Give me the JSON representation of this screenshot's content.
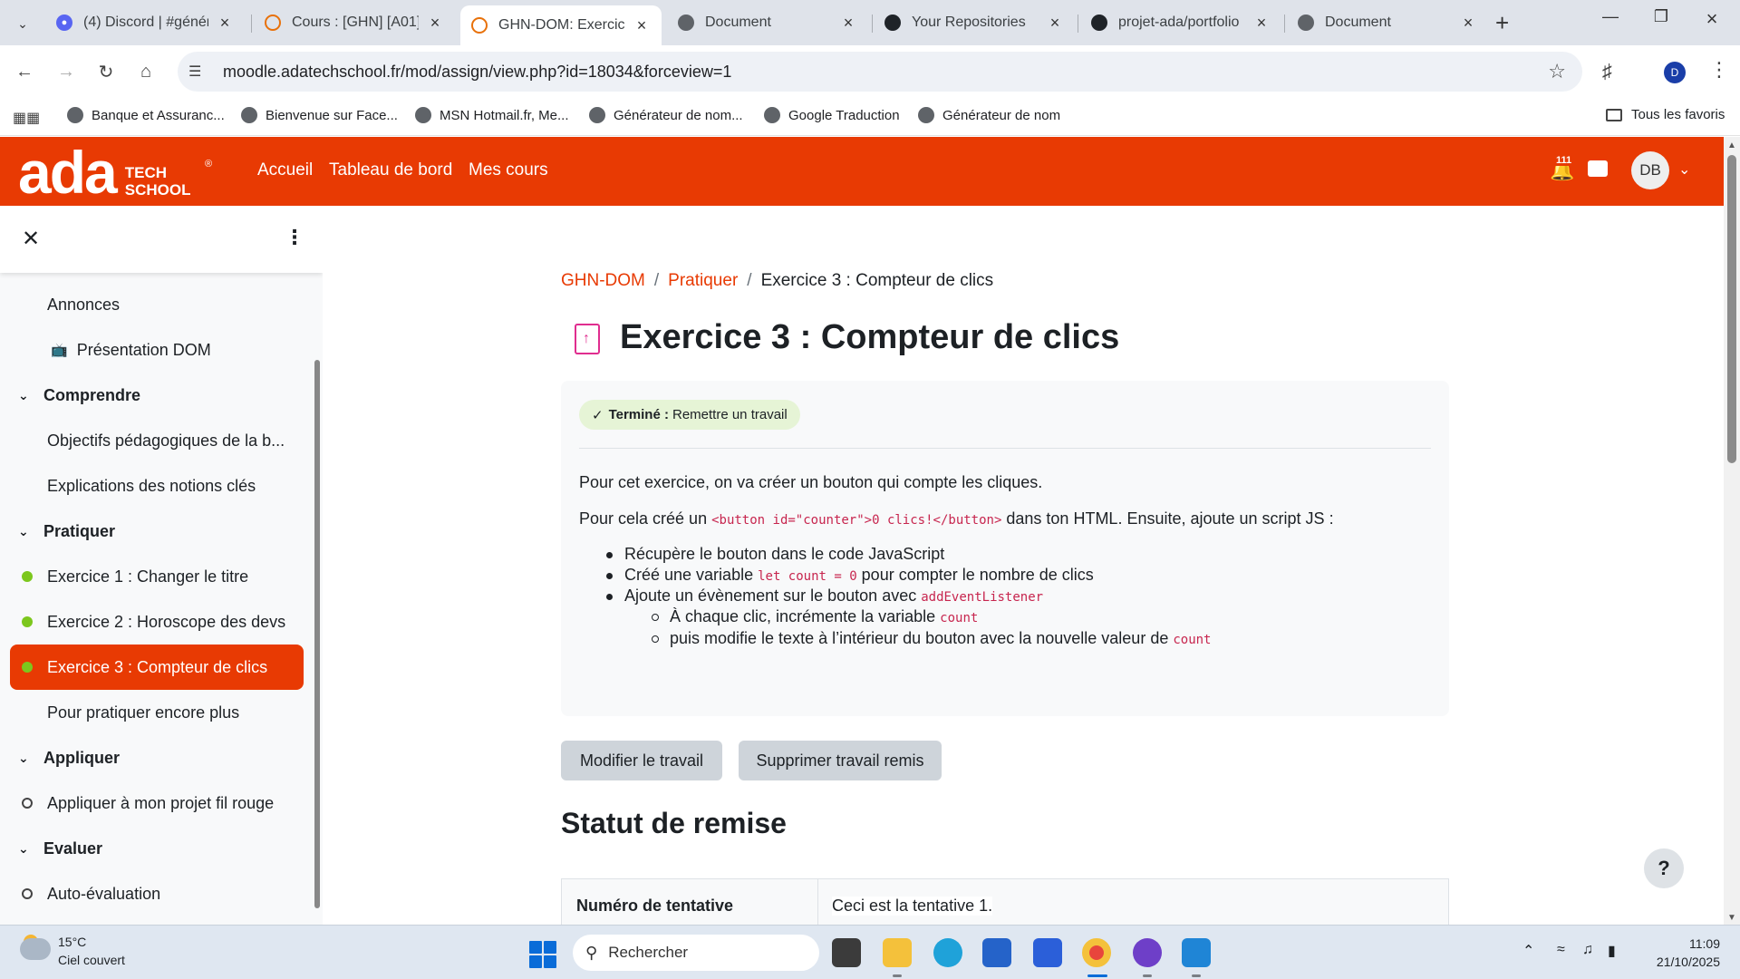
{
  "browser": {
    "tabs": [
      {
        "title": "(4) Discord | #généra",
        "icon": "discord-icon",
        "badge": "4"
      },
      {
        "title": "Cours : [GHN] [A01] T",
        "icon": "globe-icon"
      },
      {
        "title": "GHN-DOM: Exercice",
        "icon": "globe-icon",
        "active": true
      },
      {
        "title": "Document",
        "icon": "globe-icon"
      },
      {
        "title": "Your Repositories",
        "icon": "github-icon"
      },
      {
        "title": "projet-ada/portfolio",
        "icon": "github-icon"
      },
      {
        "title": "Document",
        "icon": "globe-icon"
      }
    ],
    "url": "moodle.adatechschool.fr/mod/assign/view.php?id=18034&forceview=1",
    "profile_initial": "D",
    "bookmarks": [
      "Banque et Assuranc...",
      "Bienvenue sur Face...",
      "MSN Hotmail.fr, Me...",
      "Générateur de nom...",
      "Google Traduction",
      "Générateur de nom"
    ],
    "all_bookmarks": "Tous les favoris"
  },
  "header": {
    "logo_main": "ada",
    "logo_line1": "TECH",
    "logo_line2": "SCHOOL",
    "logo_reg": "®",
    "nav": [
      "Accueil",
      "Tableau de bord",
      "Mes cours"
    ],
    "notification_count": "111",
    "user_initials": "DB",
    "brand_color": "#e83a03"
  },
  "course_index": {
    "items": [
      {
        "label": "Annonces",
        "type": "activity",
        "status": "none"
      },
      {
        "label": "Présentation DOM",
        "type": "activity",
        "status": "none",
        "icon": "tv-icon"
      },
      {
        "label": "Comprendre",
        "type": "section"
      },
      {
        "label": "Objectifs pédagogiques de la b...",
        "type": "activity",
        "status": "none"
      },
      {
        "label": "Explications des notions clés",
        "type": "activity",
        "status": "none"
      },
      {
        "label": "Pratiquer",
        "type": "section"
      },
      {
        "label": "Exercice 1 : Changer le titre",
        "type": "activity",
        "status": "done"
      },
      {
        "label": "Exercice 2 : Horoscope des devs",
        "type": "activity",
        "status": "done"
      },
      {
        "label": "Exercice 3 : Compteur de clics",
        "type": "activity",
        "status": "done",
        "active": true
      },
      {
        "label": "Pour pratiquer encore plus",
        "type": "activity",
        "status": "none"
      },
      {
        "label": "Appliquer",
        "type": "section"
      },
      {
        "label": "Appliquer à mon projet fil rouge",
        "type": "activity",
        "status": "todo"
      },
      {
        "label": "Evaluer",
        "type": "section"
      },
      {
        "label": "Auto-évaluation",
        "type": "activity",
        "status": "todo"
      }
    ]
  },
  "main": {
    "breadcrumb": [
      "GHN-DOM",
      "Pratiquer",
      "Exercice 3 : Compteur de clics"
    ],
    "title": "Exercice 3 : Compteur de clics",
    "completion": {
      "status": "Terminé :",
      "text": "Remettre un travail"
    },
    "intro": {
      "p1": "Pour cet exercice, on va créer un bouton qui compte les cliques.",
      "p2_before": "Pour cela créé un ",
      "p2_code": "<button id=\"counter\">0 clics!</button>",
      "p2_after": " dans ton HTML. Ensuite, ajoute un script JS :",
      "b1": "Récupère le bouton dans le code JavaScript",
      "b2_before": "Créé une variable ",
      "b2_code": "let count = 0",
      "b2_after": " pour compter le nombre de clics",
      "b3_before": "Ajoute un évènement sur le bouton avec ",
      "b3_code": "addEventListener",
      "s1_before": "À chaque clic, incrémente la variable ",
      "s1_code": "count",
      "s2_before": "puis modifie le texte à l’intérieur du bouton avec la nouvelle valeur de ",
      "s2_code": "count"
    },
    "buttons": {
      "edit": "Modifier le travail",
      "remove": "Supprimer travail remis"
    },
    "submission_heading": "Statut de remise",
    "submission_table": [
      {
        "key": "Numéro de tentative",
        "value": "Ceci est la tentative 1."
      }
    ],
    "help": "?"
  },
  "taskbar": {
    "temperature": "15°C",
    "weather": "Ciel couvert",
    "search_placeholder": "Rechercher",
    "time": "11:09",
    "date": "21/10/2025"
  }
}
